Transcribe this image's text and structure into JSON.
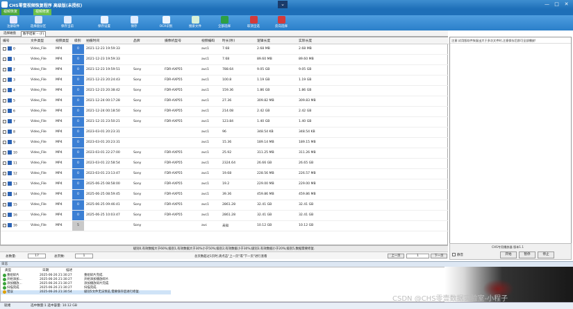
{
  "window": {
    "title": "CHS零壹视频恢复程序 高级版(未授权)",
    "dropdown_glyph": "⌄",
    "minimize": "—",
    "maximize": "□",
    "close": "✕"
  },
  "tabs": [
    {
      "label": "视频恢复"
    },
    {
      "label": "视频修复"
    }
  ],
  "toolbar": [
    {
      "label": "注册软件",
      "icon": "register-icon",
      "color": "#e8e8ff"
    },
    {
      "label": "选择盘分区",
      "icon": "partition-icon",
      "color": "#d6e4f8"
    },
    {
      "label": "保存当前",
      "icon": "save-current-icon",
      "color": "#e0ecff"
    },
    {
      "label": "保存设置",
      "icon": "settings-icon",
      "color": "#eaf2ff"
    },
    {
      "label": "保存",
      "icon": "save-icon",
      "color": "#e0ecff"
    },
    {
      "label": "OCR识别",
      "icon": "ocr-icon",
      "color": "#eef6ff"
    },
    {
      "label": "搜索文件",
      "icon": "search-file-icon",
      "color": "#d7f0d7"
    },
    {
      "label": "全部选择",
      "icon": "select-all-icon",
      "color": "#2ea043"
    },
    {
      "label": "取消全选",
      "icon": "cancel-select-icon",
      "color": "#d33a3a"
    },
    {
      "label": "反向选择",
      "icon": "invert-select-icon",
      "color": "#d33a3a"
    }
  ],
  "subtabs": [
    {
      "label": "选择磁盘"
    },
    {
      "label": "数字结果 -- (F)"
    }
  ],
  "grid": {
    "columns": [
      "编号",
      "文件类型",
      "视频类型",
      "级别",
      "拍摄时间",
      "品牌",
      "摄像机型号",
      "视频编码",
      "时长(秒)",
      "逻辑长度",
      "实际长度"
    ],
    "rows": [
      {
        "id": "0",
        "type": "Video_File",
        "vtype": "MP4",
        "grade": "0",
        "time": "2021-12-23 19:59:33",
        "brand": "",
        "model": "",
        "codec": "avc1",
        "dur": "7.68",
        "logical": "2.68 MB",
        "actual": "2.68 MB"
      },
      {
        "id": "1",
        "type": "Video_File",
        "vtype": "MP4",
        "grade": "0",
        "time": "2021-12-23 19:59:33",
        "brand": "",
        "model": "",
        "codec": "avc1",
        "dur": "7.68",
        "logical": "89.60 MB",
        "actual": "89.60 MB"
      },
      {
        "id": "2",
        "type": "Video_File",
        "vtype": "MP4",
        "grade": "0",
        "time": "2021-12-23 19:59:51",
        "brand": "Sony",
        "model": "FDR-AXP55",
        "codec": "avc1",
        "dur": "788.64",
        "logical": "9.05 GB",
        "actual": "9.05 GB"
      },
      {
        "id": "3",
        "type": "Video_File",
        "vtype": "MP4",
        "grade": "0",
        "time": "2021-12-23 20:24:43",
        "brand": "Sony",
        "model": "FDR-AXP55",
        "codec": "avc1",
        "dur": "100.8",
        "logical": "1.19 GB",
        "actual": "1.19 GB"
      },
      {
        "id": "4",
        "type": "Video_File",
        "vtype": "MP4",
        "grade": "0",
        "time": "2021-12-23 20:38:42",
        "brand": "Sony",
        "model": "FDR-AXP55",
        "codec": "avc1",
        "dur": "159.36",
        "logical": "1.86 GB",
        "actual": "1.86 GB"
      },
      {
        "id": "5",
        "type": "Video_File",
        "vtype": "MP4",
        "grade": "0",
        "time": "2021-12-24 00:17:28",
        "brand": "Sony",
        "model": "FDR-AXP55",
        "codec": "avc1",
        "dur": "27.36",
        "logical": "309.82 MB",
        "actual": "309.83 MB"
      },
      {
        "id": "6",
        "type": "Video_File",
        "vtype": "MP4",
        "grade": "0",
        "time": "2021-12-24 00:18:50",
        "brand": "Sony",
        "model": "FDR-AXP55",
        "codec": "avc1",
        "dur": "214.08",
        "logical": "2.42 GB",
        "actual": "2.42 GB"
      },
      {
        "id": "7",
        "type": "Video_File",
        "vtype": "MP4",
        "grade": "0",
        "time": "2021-12-31 23:50:21",
        "brand": "Sony",
        "model": "FDR-AXP55",
        "codec": "avc1",
        "dur": "123.84",
        "logical": "1.40 GB",
        "actual": "1.40 GB"
      },
      {
        "id": "8",
        "type": "Video_File",
        "vtype": "MP4",
        "grade": "0",
        "time": "2023-03-01 20:23:31",
        "brand": "",
        "model": "",
        "codec": "avc1",
        "dur": "96",
        "logical": "348.54 KB",
        "actual": "348.54 KB"
      },
      {
        "id": "9",
        "type": "Video_File",
        "vtype": "MP4",
        "grade": "0",
        "time": "2023-03-01 20:23:31",
        "brand": "",
        "model": "",
        "codec": "avc1",
        "dur": "15.36",
        "logical": "189.14 MB",
        "actual": "189.15 MB"
      },
      {
        "id": "10",
        "type": "Video_File",
        "vtype": "MP4",
        "grade": "0",
        "time": "2023-03-01 22:27:00",
        "brand": "Sony",
        "model": "FDR-AXP55",
        "codec": "avc1",
        "dur": "25.92",
        "logical": "311.25 MB",
        "actual": "311.26 MB"
      },
      {
        "id": "11",
        "type": "Video_File",
        "vtype": "MP4",
        "grade": "0",
        "time": "2023-03-01 22:58:54",
        "brand": "Sony",
        "model": "FDR-AXP55",
        "codec": "avc1",
        "dur": "2324.64",
        "logical": "26.66 GB",
        "actual": "26.65 GB"
      },
      {
        "id": "12",
        "type": "Video_File",
        "vtype": "MP4",
        "grade": "0",
        "time": "2023-03-01 23:13:47",
        "brand": "Sony",
        "model": "FDR-AXP55",
        "codec": "avc1",
        "dur": "19.68",
        "logical": "228.56 MB",
        "actual": "226.57 MB"
      },
      {
        "id": "13",
        "type": "Video_File",
        "vtype": "MP4",
        "grade": "0",
        "time": "2025-06-25 08:58:00",
        "brand": "Sony",
        "model": "FDR-AXP55",
        "codec": "avc1",
        "dur": "19.2",
        "logical": "229.00 MB",
        "actual": "229.00 MB"
      },
      {
        "id": "14",
        "type": "Video_File",
        "vtype": "MP4",
        "grade": "0",
        "time": "2025-06-25 08:59:45",
        "brand": "Sony",
        "model": "FDR-AXP55",
        "codec": "avc1",
        "dur": "39.36",
        "logical": "459.86 MB",
        "actual": "459.86 MB"
      },
      {
        "id": "15",
        "type": "Video_File",
        "vtype": "MP4",
        "grade": "0",
        "time": "2025-06-25 09:46:41",
        "brand": "Sony",
        "model": "FDR-AXP55",
        "codec": "avc1",
        "dur": "2861.28",
        "logical": "32.41 GB",
        "actual": "32.41 GB"
      },
      {
        "id": "16",
        "type": "Video_File",
        "vtype": "MP4",
        "grade": "0",
        "time": "2025-06-25 10:03:47",
        "brand": "Sony",
        "model": "FDR-AXP55",
        "codec": "avc1",
        "dur": "2861.28",
        "logical": "32.41 GB",
        "actual": "32.41 GB"
      },
      {
        "id": "16",
        "type": "Video_File",
        "vtype": "MP4",
        "grade": "5",
        "time": "",
        "brand": "Sony",
        "model": "",
        "codec": "avc",
        "dur": "未知",
        "logical": "10.12 GB",
        "actual": "10.12 GB"
      }
    ]
  },
  "status": {
    "message": "级别0,有效数据大于60%;级别1,有效数据大于30%小于50%;级别2,有效数据小于30%;级别3,有效数据小于20%;级别5,数据需要修复."
  },
  "pager": {
    "total_label": "总数量:",
    "total_value": "17",
    "pages_label": "总页数:",
    "pages_value": "1",
    "hint": "总页数超过1页时,请点击\"上一页\"或\"下一页\"进行查看",
    "prev": "上一页",
    "page_value": "1",
    "next": "下一页"
  },
  "right_panel": {
    "note": "注意:试用版软件恢复出大于多次文件时,注意保存后即可全部播放!",
    "version": "CHS专用播放器 版本1.1",
    "checkbox_label": "静音",
    "buttons": [
      "开始",
      "暂停",
      "停止"
    ]
  },
  "log": {
    "title": "日志",
    "headers": [
      "类型",
      "日期",
      "描述"
    ],
    "rows": [
      {
        "kind": "成功",
        "type": "重组碎片",
        "date": "2025-06-26 21:30:27",
        "desc": "重组碎片完成."
      },
      {
        "kind": "成功",
        "type": "开始添加...",
        "date": "2025-06-26 21:30:27",
        "desc": "开始添加播放碎片."
      },
      {
        "kind": "成功",
        "type": "添加播放...",
        "date": "2025-06-26 21:30:27",
        "desc": "添加播放碎片完成."
      },
      {
        "kind": "成功",
        "type": "扫描完成",
        "date": "2025-06-26 21:30:27",
        "desc": "扫描完成."
      },
      {
        "kind": "警告",
        "type": "错误",
        "date": "2025-06-26 21:30:54",
        "desc": "级别5文件无法预览,需要保存后进行修复."
      }
    ]
  },
  "footer": {
    "state": "就绪",
    "selection": "选中数量:1 选中容量: 10.12 GB"
  },
  "watermark": "CSDN @CHS零壹数据实验室-小程子"
}
